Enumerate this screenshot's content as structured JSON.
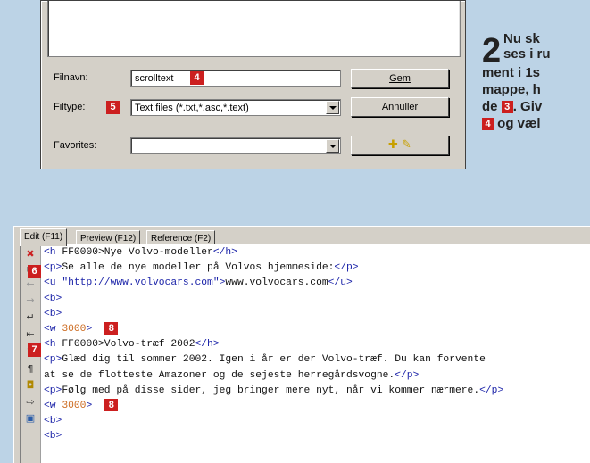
{
  "dialog": {
    "filename_label": "Filnavn:",
    "filename_value": "scrolltext",
    "filetype_label": "Filtype:",
    "filetype_value": "Text files (*.txt,*.asc,*.text)",
    "favorites_label": "Favorites:",
    "favorites_value": "",
    "save_button": "Gem",
    "cancel_button": "Annuller",
    "badge_filename": "4",
    "badge_filetype": "5"
  },
  "step": {
    "number": "2",
    "lines": [
      "Nu sk",
      "ses i ru",
      "ment i 1s",
      "mappe, h",
      "de",
      ". Giv",
      "og væl"
    ],
    "badge_3": "3",
    "badge_4": "4"
  },
  "editor": {
    "tabs": [
      {
        "label": "Edit (F11)",
        "active": true
      },
      {
        "label": "Preview (F12)",
        "active": false
      },
      {
        "label": "Reference (F2)",
        "active": false
      }
    ],
    "gutter_icons": [
      "close-icon",
      "undock-icon",
      "back-icon",
      "forward-icon",
      "wrap-icon",
      "indent-icon",
      "hash-icon",
      "pilcrow-icon",
      "save-icon",
      "export-icon",
      "window-icon"
    ],
    "gutter_glyphs": [
      "✖",
      "⧉",
      "←",
      "→",
      "↵",
      "⇤",
      "#",
      "¶",
      "◘",
      "⇨",
      "▣"
    ],
    "badge_6": "6",
    "badge_7": "7",
    "badge_8": "8",
    "lines": [
      [
        {
          "t": "<h ",
          "c": "tg"
        },
        {
          "t": "FF0000>Nye Volvo-modeller",
          "c": ""
        },
        {
          "t": "</h>",
          "c": "tg"
        }
      ],
      [
        {
          "t": "<p>",
          "c": "tg"
        },
        {
          "t": "Se alle de nye modeller på Volvos hjemmeside:",
          "c": ""
        },
        {
          "t": "</p>",
          "c": "tg"
        }
      ],
      [
        {
          "t": "<u ",
          "c": "tg"
        },
        {
          "t": "\"http://www.volvocars.com\">",
          "c": "tg"
        },
        {
          "t": "www.volvocars.com",
          "c": ""
        },
        {
          "t": "</u>",
          "c": "tg"
        }
      ],
      [
        {
          "t": "<b>",
          "c": "tg"
        }
      ],
      [
        {
          "t": "<b>",
          "c": "tg"
        }
      ],
      [
        {
          "t": "<w ",
          "c": "tg"
        },
        {
          "t": "3000",
          "c": "nm"
        },
        {
          "t": ">",
          "c": "tg"
        }
      ],
      [
        {
          "t": "<h ",
          "c": "tg"
        },
        {
          "t": "FF0000>Volvo-træf 2002",
          "c": ""
        },
        {
          "t": "</h>",
          "c": "tg"
        }
      ],
      [
        {
          "t": "<p>",
          "c": "tg"
        },
        {
          "t": "Glæd dig til sommer 2002. Igen i år er der Volvo-træf. Du kan forvente",
          "c": ""
        }
      ],
      [
        {
          "t": "at se de flotteste Amazoner og de sejeste herregårdsvogne.",
          "c": ""
        },
        {
          "t": "</p>",
          "c": "tg"
        }
      ],
      [
        {
          "t": "<p>",
          "c": "tg"
        },
        {
          "t": "Følg med på disse sider, jeg bringer mere nyt, når vi kommer nærmere.",
          "c": ""
        },
        {
          "t": "</p>",
          "c": "tg"
        }
      ],
      [
        {
          "t": "<w ",
          "c": "tg"
        },
        {
          "t": "3000",
          "c": "nm"
        },
        {
          "t": ">",
          "c": "tg"
        }
      ],
      [
        {
          "t": "<b>",
          "c": "tg"
        }
      ],
      [
        {
          "t": "<b>",
          "c": "tg"
        }
      ]
    ]
  }
}
